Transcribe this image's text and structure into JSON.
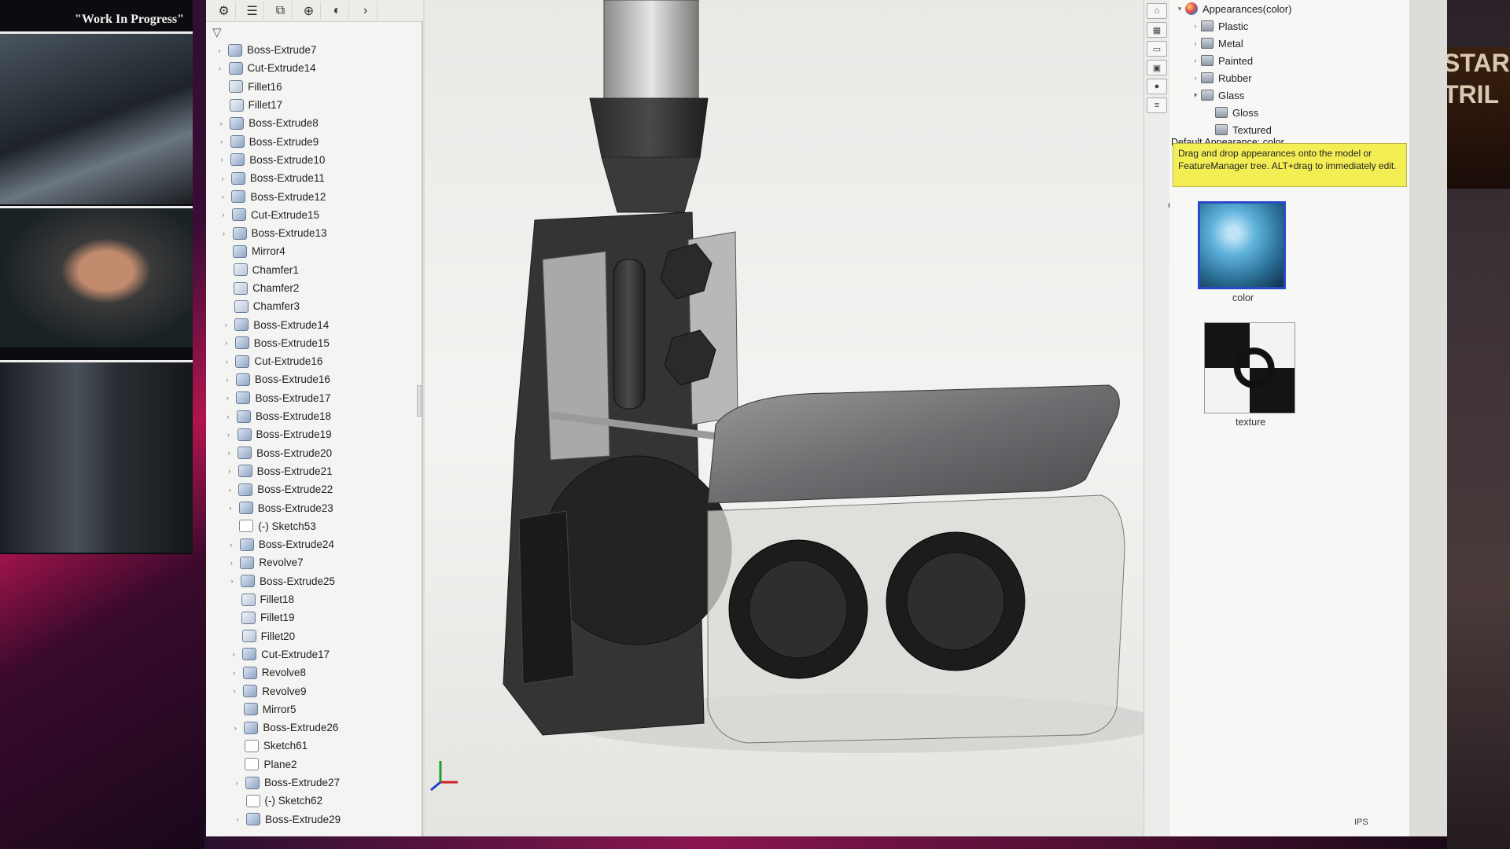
{
  "left_panel": {
    "title": "\"Work In Progress\""
  },
  "feature_tree": {
    "items": [
      {
        "label": "Boss-Extrude7",
        "type": "boss",
        "expandable": true
      },
      {
        "label": "Cut-Extrude14",
        "type": "cut",
        "expandable": true
      },
      {
        "label": "Fillet16",
        "type": "fillet",
        "expandable": false
      },
      {
        "label": "Fillet17",
        "type": "fillet",
        "expandable": false
      },
      {
        "label": "Boss-Extrude8",
        "type": "boss",
        "expandable": true
      },
      {
        "label": "Boss-Extrude9",
        "type": "boss",
        "expandable": true
      },
      {
        "label": "Boss-Extrude10",
        "type": "boss",
        "expandable": true
      },
      {
        "label": "Boss-Extrude11",
        "type": "boss",
        "expandable": true
      },
      {
        "label": "Boss-Extrude12",
        "type": "boss",
        "expandable": true
      },
      {
        "label": "Cut-Extrude15",
        "type": "cut",
        "expandable": true
      },
      {
        "label": "Boss-Extrude13",
        "type": "boss",
        "expandable": true
      },
      {
        "label": "Mirror4",
        "type": "mirror",
        "expandable": false
      },
      {
        "label": "Chamfer1",
        "type": "fillet",
        "expandable": false
      },
      {
        "label": "Chamfer2",
        "type": "fillet",
        "expandable": false
      },
      {
        "label": "Chamfer3",
        "type": "fillet",
        "expandable": false
      },
      {
        "label": "Boss-Extrude14",
        "type": "boss",
        "expandable": true
      },
      {
        "label": "Boss-Extrude15",
        "type": "boss",
        "expandable": true
      },
      {
        "label": "Cut-Extrude16",
        "type": "cut",
        "expandable": true
      },
      {
        "label": "Boss-Extrude16",
        "type": "boss",
        "expandable": true
      },
      {
        "label": "Boss-Extrude17",
        "type": "boss",
        "expandable": true
      },
      {
        "label": "Boss-Extrude18",
        "type": "boss",
        "expandable": true
      },
      {
        "label": "Boss-Extrude19",
        "type": "boss",
        "expandable": true
      },
      {
        "label": "Boss-Extrude20",
        "type": "boss",
        "expandable": true
      },
      {
        "label": "Boss-Extrude21",
        "type": "boss",
        "expandable": true
      },
      {
        "label": "Boss-Extrude22",
        "type": "boss",
        "expandable": true
      },
      {
        "label": "Boss-Extrude23",
        "type": "boss",
        "expandable": true
      },
      {
        "label": "(-) Sketch53",
        "type": "sketch",
        "expandable": false
      },
      {
        "label": "Boss-Extrude24",
        "type": "boss",
        "expandable": true
      },
      {
        "label": "Revolve7",
        "type": "revolve",
        "expandable": true
      },
      {
        "label": "Boss-Extrude25",
        "type": "boss",
        "expandable": true
      },
      {
        "label": "Fillet18",
        "type": "fillet",
        "expandable": false
      },
      {
        "label": "Fillet19",
        "type": "fillet",
        "expandable": false
      },
      {
        "label": "Fillet20",
        "type": "fillet",
        "expandable": false
      },
      {
        "label": "Cut-Extrude17",
        "type": "cut",
        "expandable": true
      },
      {
        "label": "Revolve8",
        "type": "revolve",
        "expandable": true
      },
      {
        "label": "Revolve9",
        "type": "revolve",
        "expandable": true
      },
      {
        "label": "Mirror5",
        "type": "mirror",
        "expandable": false
      },
      {
        "label": "Boss-Extrude26",
        "type": "boss",
        "expandable": true
      },
      {
        "label": "Sketch61",
        "type": "sketch",
        "expandable": false
      },
      {
        "label": "Plane2",
        "type": "sketch",
        "expandable": false
      },
      {
        "label": "Boss-Extrude27",
        "type": "boss",
        "expandable": true
      },
      {
        "label": "(-) Sketch62",
        "type": "sketch",
        "expandable": false
      },
      {
        "label": "Boss-Extrude29",
        "type": "boss",
        "expandable": true
      }
    ]
  },
  "appearances": {
    "root": "Appearances(color)",
    "children": [
      "Plastic",
      "Metal",
      "Painted",
      "Rubber",
      "Glass"
    ],
    "glass_children": [
      "Gloss",
      "Textured"
    ],
    "default_label": "Default Appearance: color",
    "hint": "Drag and drop appearances onto the model or FeatureManager tree.  ALT+drag to immediately edit.",
    "swatches": [
      {
        "label": "color"
      },
      {
        "label": "texture"
      }
    ]
  },
  "status": {
    "units": "IPS"
  },
  "right_poster": {
    "text": "STAR TRIL"
  }
}
